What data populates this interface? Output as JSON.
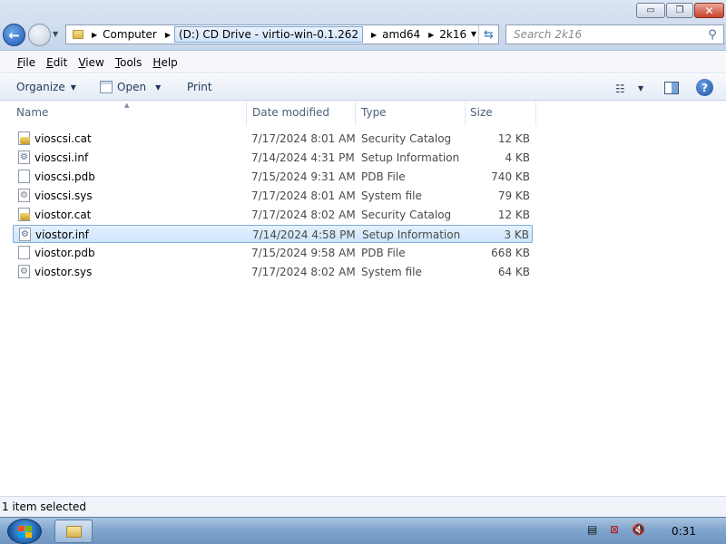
{
  "window": {
    "controls": {
      "minimize": "▭",
      "maximize": "❐",
      "close": "✕"
    }
  },
  "address": {
    "segments": [
      "Computer",
      "(D:) CD Drive - virtio-win-0.1.262",
      "amd64",
      "2k16"
    ]
  },
  "search": {
    "placeholder": "Search 2k16"
  },
  "menu": [
    "File",
    "Edit",
    "View",
    "Tools",
    "Help"
  ],
  "commands": {
    "organize": "Organize",
    "open": "Open",
    "print": "Print"
  },
  "columns": {
    "name": "Name",
    "date": "Date modified",
    "type": "Type",
    "size": "Size"
  },
  "files": [
    {
      "name": "vioscsi.cat",
      "date": "7/17/2024 8:01 AM",
      "type": "Security Catalog",
      "size": "12 KB",
      "icon": "cat"
    },
    {
      "name": "vioscsi.inf",
      "date": "7/14/2024 4:31 PM",
      "type": "Setup Information",
      "size": "4 KB",
      "icon": "inf"
    },
    {
      "name": "vioscsi.pdb",
      "date": "7/15/2024 9:31 AM",
      "type": "PDB File",
      "size": "740 KB",
      "icon": "pdb"
    },
    {
      "name": "vioscsi.sys",
      "date": "7/17/2024 8:01 AM",
      "type": "System file",
      "size": "79 KB",
      "icon": "sys"
    },
    {
      "name": "viostor.cat",
      "date": "7/17/2024 8:02 AM",
      "type": "Security Catalog",
      "size": "12 KB",
      "icon": "cat"
    },
    {
      "name": "viostor.inf",
      "date": "7/14/2024 4:58 PM",
      "type": "Setup Information",
      "size": "3 KB",
      "icon": "inf"
    },
    {
      "name": "viostor.pdb",
      "date": "7/15/2024 9:58 AM",
      "type": "PDB File",
      "size": "668 KB",
      "icon": "pdb"
    },
    {
      "name": "viostor.sys",
      "date": "7/17/2024 8:02 AM",
      "type": "System file",
      "size": "64 KB",
      "icon": "sys"
    }
  ],
  "selected_index": 5,
  "status": {
    "text": "1 item selected"
  },
  "taskbar": {
    "clock": "0:31"
  },
  "colors": {
    "accent": "#1e395b",
    "selection": "#cde4fb",
    "selection_border": "#84acdd"
  }
}
